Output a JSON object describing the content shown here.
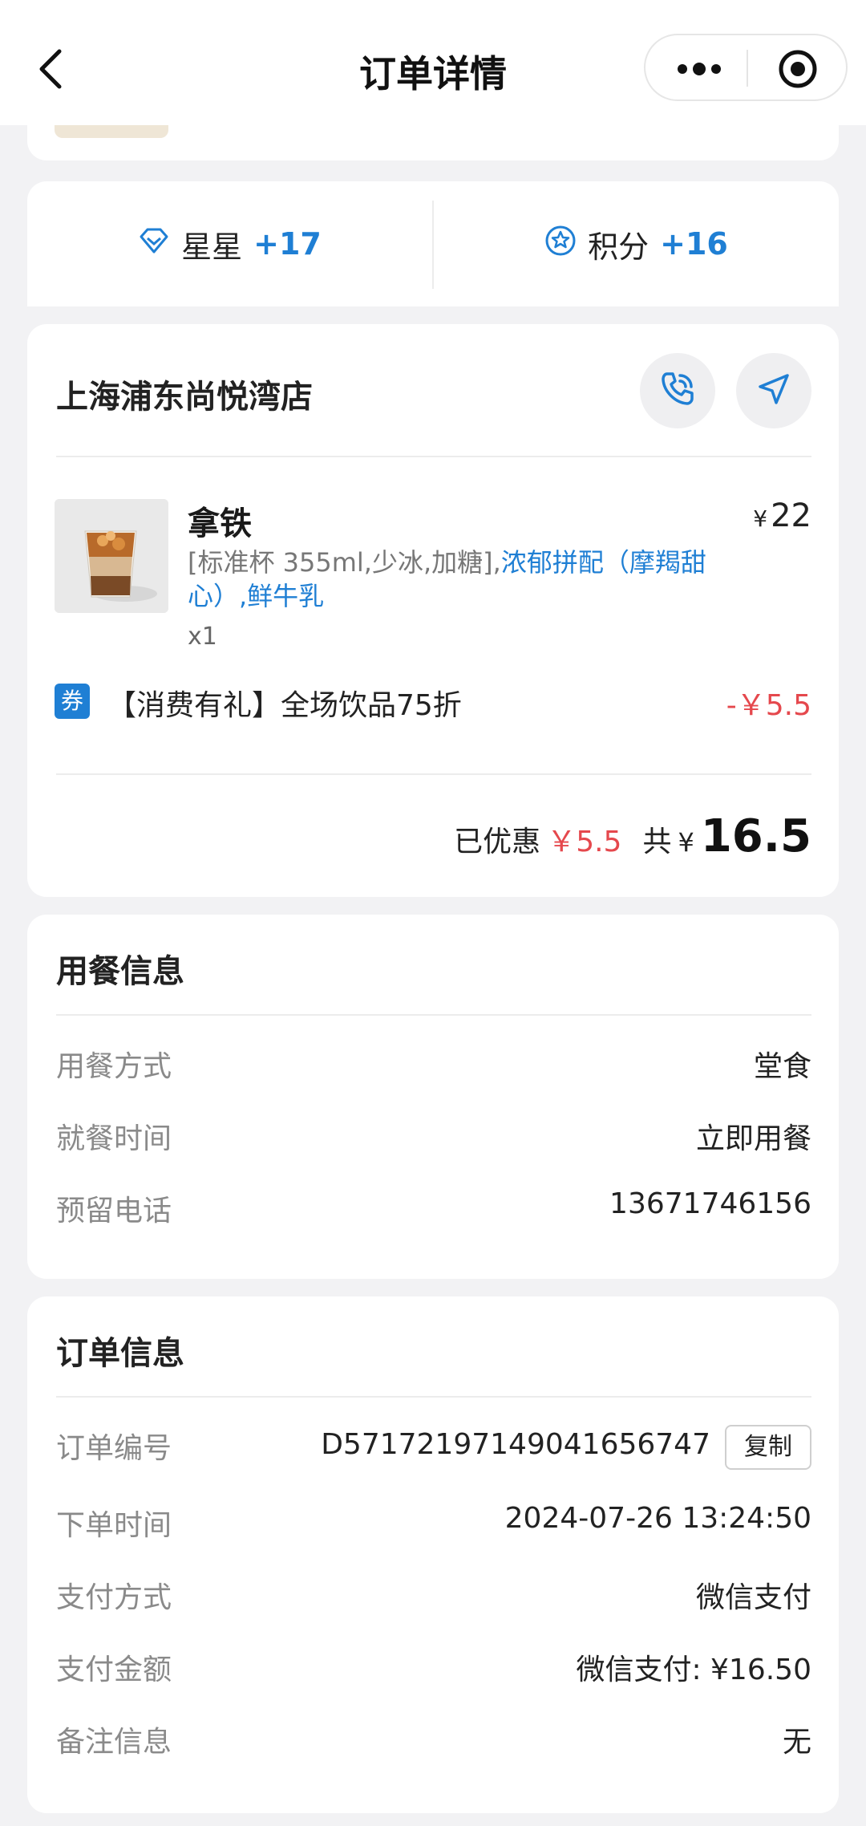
{
  "header": {
    "title": "订单详情"
  },
  "rewards": {
    "stars": {
      "label": "星星",
      "value": "+17"
    },
    "points": {
      "label": "积分",
      "value": "+16"
    }
  },
  "store": {
    "name": "上海浦东尚悦湾店",
    "product": {
      "name": "拿铁",
      "price_symbol": "¥",
      "price": "22",
      "spec_plain": "[标准杯 355ml,少冰,加糖],",
      "spec_highlight": "浓郁拼配（摩羯甜心）,鲜牛乳",
      "quantity": "x1"
    },
    "coupon": {
      "tag": "券",
      "text": "【消费有礼】全场饮品75折",
      "amount": "-￥5.5"
    },
    "summary": {
      "discount_label": "已优惠",
      "discount_value": "￥5.5",
      "total_label": "共",
      "total_symbol": "¥",
      "total_value": "16.5"
    }
  },
  "dining": {
    "title": "用餐信息",
    "rows": [
      {
        "label": "用餐方式",
        "value": "堂食"
      },
      {
        "label": "就餐时间",
        "value": "立即用餐"
      },
      {
        "label": "预留电话",
        "value": "13671746156"
      }
    ]
  },
  "order": {
    "title": "订单信息",
    "copy_label": "复制",
    "rows": [
      {
        "label": "订单编号",
        "value": "D57172197149041656747"
      },
      {
        "label": "下单时间",
        "value": "2024-07-26 13:24:50"
      },
      {
        "label": "支付方式",
        "value": "微信支付"
      },
      {
        "label": "支付金额",
        "value": "微信支付: ¥16.50"
      },
      {
        "label": "备注信息",
        "value": "无"
      }
    ]
  },
  "colors": {
    "accent": "#1f7fd4",
    "discount": "#e5484d",
    "background": "#f2f2f4"
  },
  "icons": [
    "back-icon",
    "more-icon",
    "target-icon",
    "diamond-icon",
    "star-badge-icon",
    "phone-icon",
    "navigate-icon"
  ]
}
